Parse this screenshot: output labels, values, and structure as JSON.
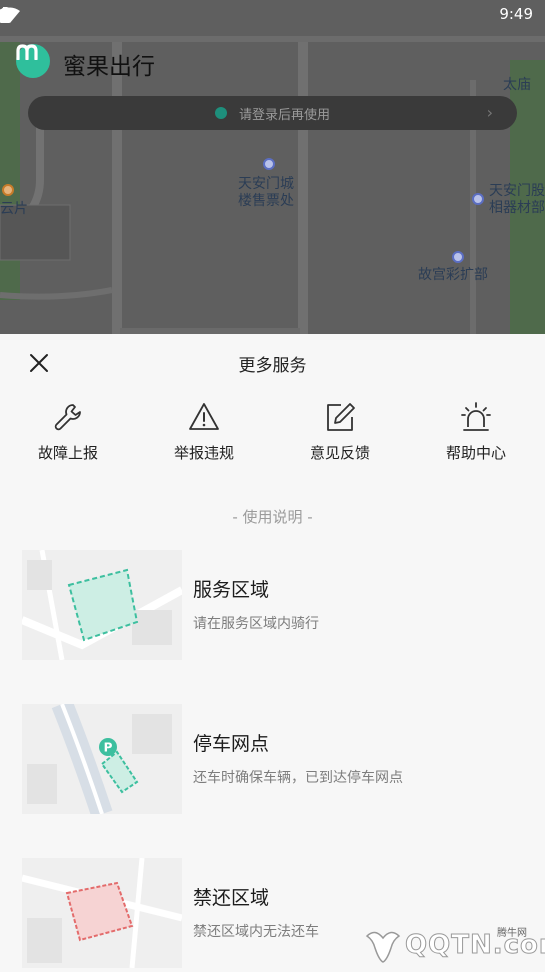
{
  "status_bar": {
    "time": "9:49"
  },
  "app": {
    "title": "蜜果出行",
    "logo_letter": "m"
  },
  "login_banner": {
    "text": "请登录后再使用"
  },
  "map": {
    "pois": [
      {
        "line1": "天安门城",
        "line2": "楼售票处"
      },
      {
        "line1": "天安门股",
        "line2": "相器材部"
      },
      {
        "line1": "故宫彩扩部",
        "line2": ""
      },
      {
        "line1": "太庙",
        "line2": ""
      },
      {
        "line1": "云片",
        "line2": ""
      }
    ]
  },
  "sheet": {
    "title": "更多服务",
    "services": [
      {
        "label": "故障上报",
        "icon": "wrench-icon"
      },
      {
        "label": "举报违规",
        "icon": "warning-icon"
      },
      {
        "label": "意见反馈",
        "icon": "edit-icon"
      },
      {
        "label": "帮助中心",
        "icon": "siren-icon"
      }
    ],
    "section_title": "- 使用说明 -",
    "guides": [
      {
        "title": "服务区域",
        "desc": "请在服务区域内骑行",
        "color": "#3dbf9f"
      },
      {
        "title": "停车网点",
        "desc": "还车时确保车辆，已到达停车网点",
        "color": "#3dbf9f",
        "badge": "P"
      },
      {
        "title": "禁还区域",
        "desc": "禁还区域内无法还车",
        "color": "#e36b6b"
      }
    ]
  },
  "watermark": {
    "text": "QQTN.com",
    "small": "腾牛网"
  }
}
